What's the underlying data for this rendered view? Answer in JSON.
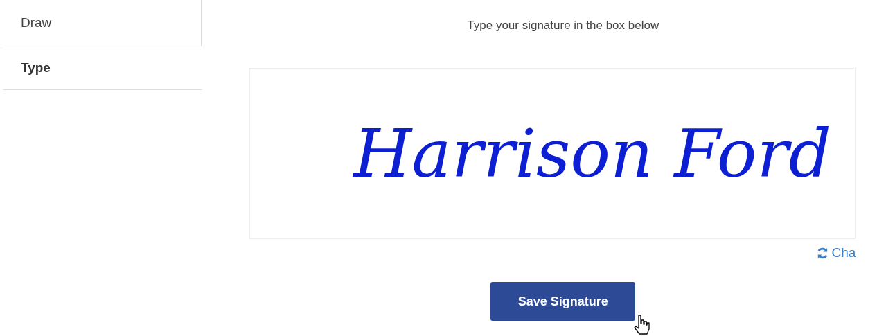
{
  "sidebar": {
    "items": [
      {
        "label": "Draw",
        "selected": false
      },
      {
        "label": "Type",
        "selected": true
      }
    ]
  },
  "instruction": "Type your signature in the box below",
  "signature": {
    "value": "Harrison Ford"
  },
  "change_link": "Cha",
  "save_button": "Save Signature"
}
